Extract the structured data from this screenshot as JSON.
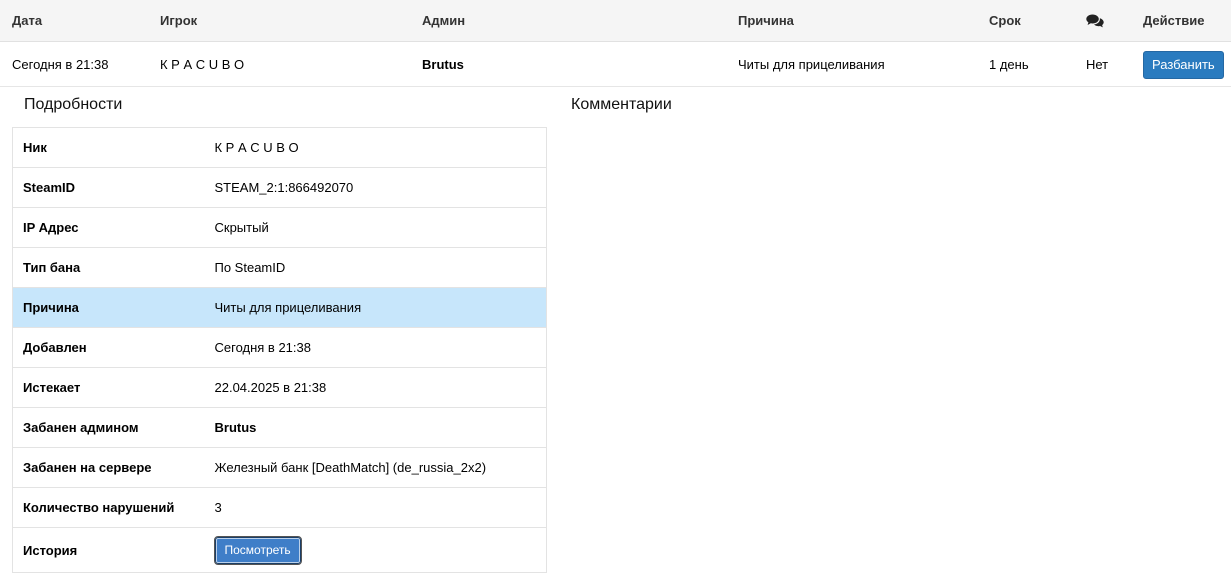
{
  "table": {
    "headers": {
      "date": "Дата",
      "player": "Игрок",
      "admin": "Админ",
      "reason": "Причина",
      "term": "Срок",
      "action": "Действие"
    },
    "row": {
      "date": "Сегодня в 21:38",
      "player": "К Р А С U В О",
      "admin": "Brutus",
      "reason": "Читы для прицеливания",
      "term": "1 день",
      "comments": "Нет",
      "unban_label": "Разбанить"
    }
  },
  "details": {
    "title": "Подробности",
    "rows": [
      {
        "label": "Ник",
        "value": "К Р А С U В О"
      },
      {
        "label": "SteamID",
        "value": "STEAM_2:1:866492070"
      },
      {
        "label": "IP Адрес",
        "value": "Скрытый"
      },
      {
        "label": "Тип бана",
        "value": "По SteamID"
      },
      {
        "label": "Причина",
        "value": "Читы для прицеливания"
      },
      {
        "label": "Добавлен",
        "value": "Сегодня в 21:38"
      },
      {
        "label": "Истекает",
        "value": "22.04.2025 в 21:38"
      },
      {
        "label": "Забанен админом",
        "value": "Brutus"
      },
      {
        "label": "Забанен на сервере",
        "value": "Железный банк [DeathMatch] (de_russia_2x2)"
      },
      {
        "label": "Количество нарушений",
        "value": "3"
      },
      {
        "label": "История",
        "button_label": "Посмотреть"
      }
    ]
  },
  "comments": {
    "title": "Комментарии"
  },
  "icons": {
    "comments_header": "comments-icon"
  },
  "colors": {
    "header_bg": "#f5f5f5",
    "highlight_row": "#c7e6fb",
    "primary_button": "#2a7bbf"
  }
}
